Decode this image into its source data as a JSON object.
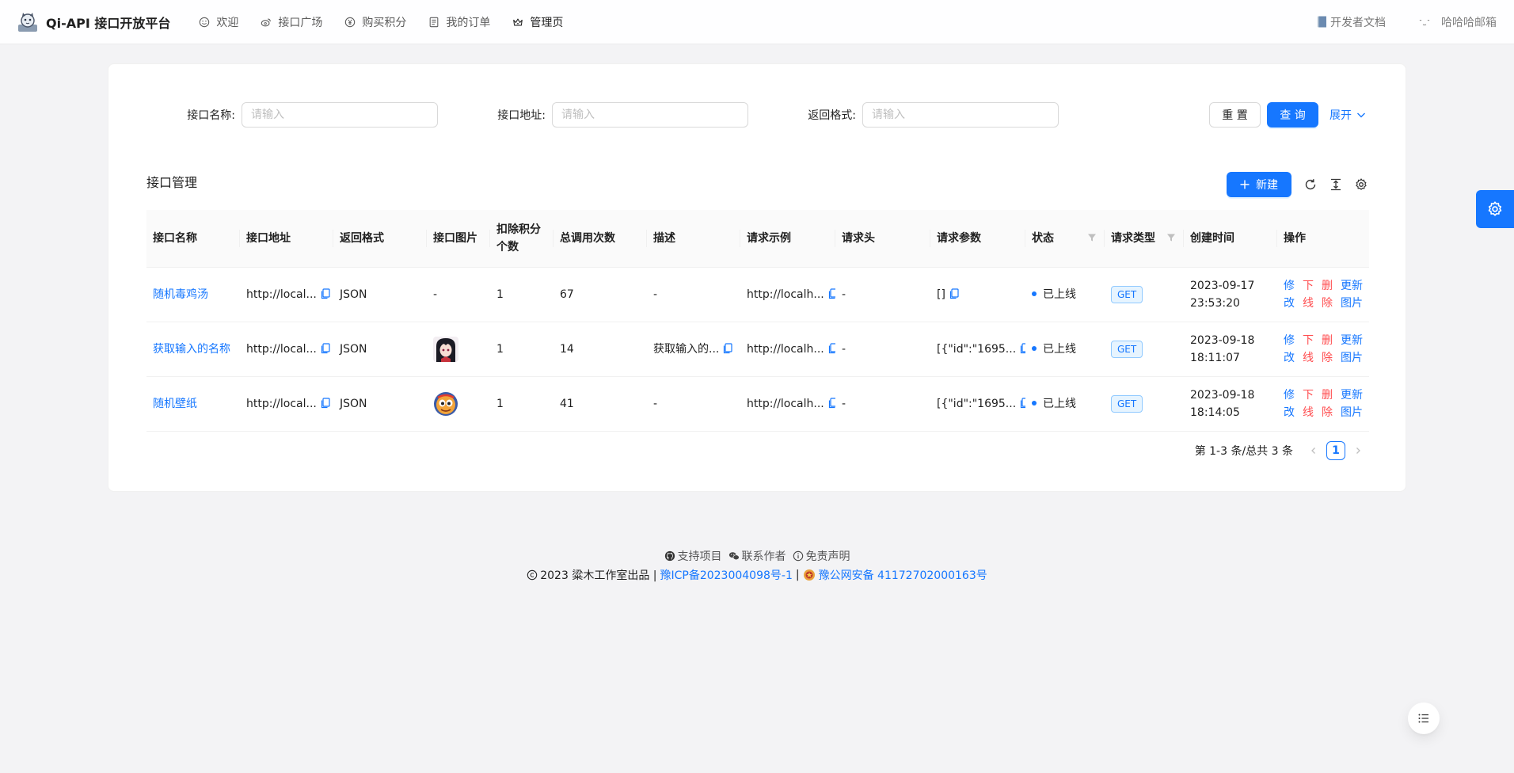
{
  "header": {
    "brand": "Qi-API 接口开放平台",
    "nav": [
      {
        "label": "欢迎",
        "icon": "smile-icon"
      },
      {
        "label": "接口广场",
        "icon": "weibo-icon"
      },
      {
        "label": "购买积分",
        "icon": "yuan-circle-icon"
      },
      {
        "label": "我的订单",
        "icon": "profile-icon"
      },
      {
        "label": "管理页",
        "icon": "crown-icon"
      }
    ],
    "active_nav": "管理页",
    "doc_link": "开发者文档",
    "username": "哈哈哈邮箱"
  },
  "search": {
    "name_label": "接口名称:",
    "name_placeholder": "请输入",
    "url_label": "接口地址:",
    "url_placeholder": "请输入",
    "format_label": "返回格式:",
    "format_placeholder": "请输入",
    "reset": "重 置",
    "query": "查 询",
    "expand": "展开"
  },
  "table_toolbar": {
    "title": "接口管理",
    "new_button": "新建"
  },
  "table": {
    "columns": [
      "接口名称",
      "接口地址",
      "返回格式",
      "接口图片",
      "扣除积分个数",
      "总调用次数",
      "描述",
      "请求示例",
      "请求头",
      "请求参数",
      "状态",
      "请求类型",
      "创建时间",
      "操作"
    ],
    "rows": [
      {
        "name": "随机毒鸡汤",
        "url": "http://local...",
        "format": "JSON",
        "image": "-",
        "points": "1",
        "calls": "67",
        "desc": "-",
        "example": "http://localh...",
        "headers": "-",
        "params": "[]",
        "status": "已上线",
        "method": "GET",
        "date": "2023-09-17",
        "time": "23:53:20"
      },
      {
        "name": "获取输入的名称",
        "url": "http://local...",
        "format": "JSON",
        "image": "anime-avatar",
        "points": "1",
        "calls": "14",
        "desc": "获取输入的...",
        "example": "http://localh...",
        "headers": "-",
        "params": "[{\"id\":\"1695...",
        "status": "已上线",
        "method": "GET",
        "date": "2023-09-18",
        "time": "18:11:07"
      },
      {
        "name": "随机壁纸",
        "url": "http://local...",
        "format": "JSON",
        "image": "cartoon-avatar",
        "points": "1",
        "calls": "41",
        "desc": "-",
        "example": "http://localh...",
        "headers": "-",
        "params": "[{\"id\":\"1695...",
        "status": "已上线",
        "method": "GET",
        "date": "2023-09-18",
        "time": "18:14:05"
      }
    ],
    "ops": [
      {
        "top": "修",
        "bottom": "改"
      },
      {
        "top": "下",
        "bottom": "线"
      },
      {
        "top": "删",
        "bottom": "除"
      },
      {
        "top": "更新",
        "bottom": "图片"
      }
    ]
  },
  "pagination": {
    "total": "第 1-3 条/总共 3 条",
    "current": "1"
  },
  "footer": {
    "links": [
      "支持项目",
      "联系作者",
      "免责声明"
    ],
    "copyright": "2023 粱木工作室出品 |",
    "icp": "豫ICP备2023004098号-1",
    "sep": "|",
    "police": "豫公网安备 41172702000163号"
  },
  "colors": {
    "primary": "#1677ff",
    "danger": "#ff4d4f"
  }
}
